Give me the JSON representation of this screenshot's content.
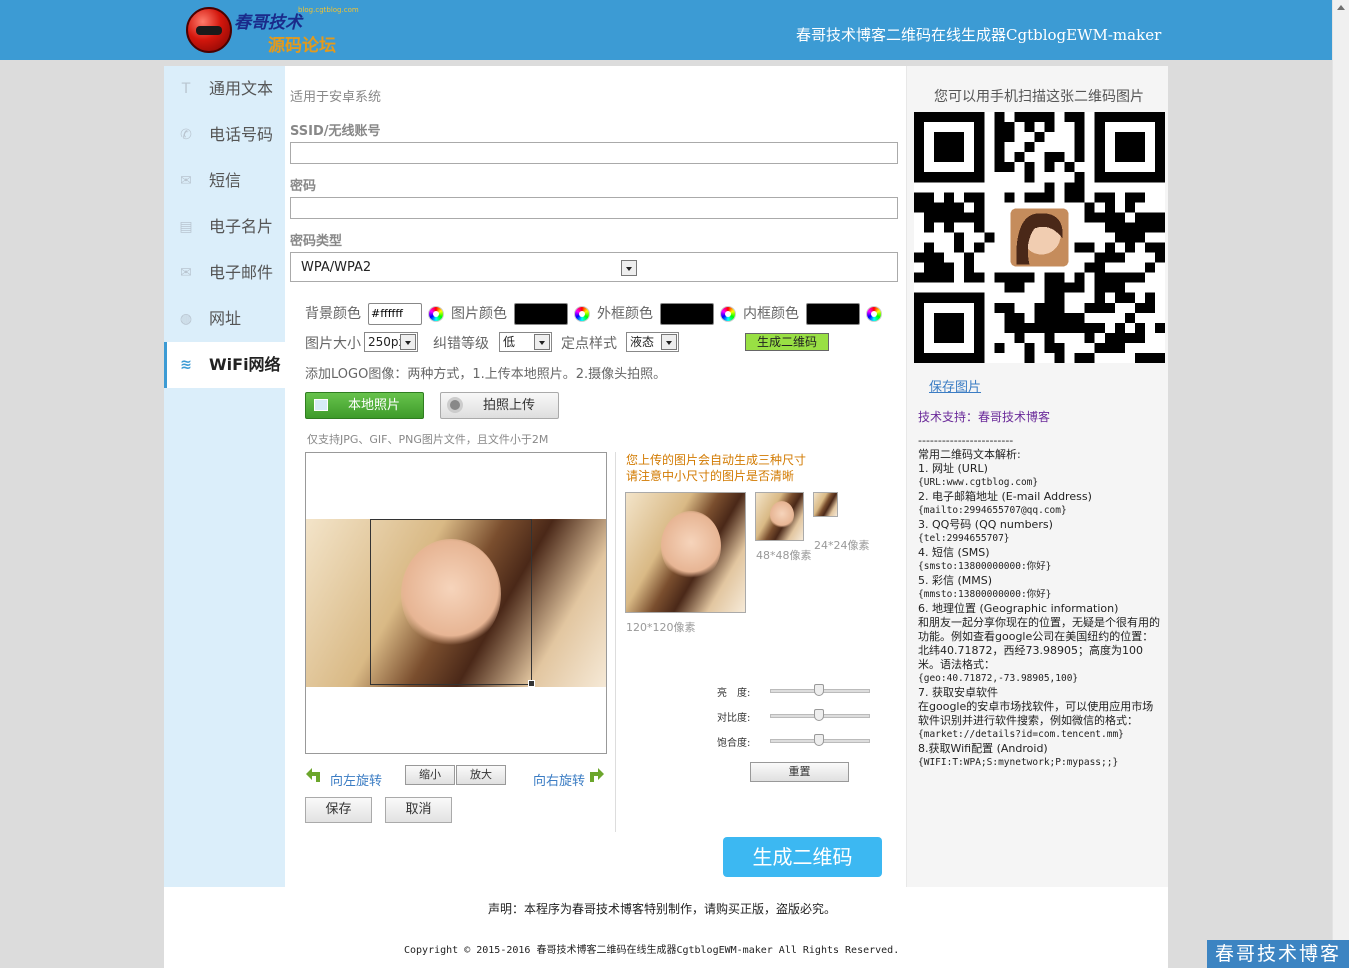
{
  "header": {
    "logo_line1": "春哥技术",
    "logo_line2": "源码论坛",
    "logo_url": "blog.cgtblog.com",
    "title": "春哥技术博客二维码在线生成器CgtblogEWM-maker"
  },
  "sidebar": {
    "items": [
      {
        "label": "通用文本",
        "icon": "text-icon",
        "glyph": "T"
      },
      {
        "label": "电话号码",
        "icon": "phone-icon",
        "glyph": "✆"
      },
      {
        "label": "短信",
        "icon": "chat-icon",
        "glyph": "✉"
      },
      {
        "label": "电子名片",
        "icon": "card-icon",
        "glyph": "▤"
      },
      {
        "label": "电子邮件",
        "icon": "mail-icon",
        "glyph": "✉"
      },
      {
        "label": "网址",
        "icon": "globe-icon",
        "glyph": "◍"
      },
      {
        "label": "WiFi网络",
        "icon": "wifi-icon",
        "glyph": "≋",
        "active": true
      }
    ]
  },
  "form": {
    "hint": "适用于安卓系统",
    "ssid_label": "SSID/无线账号",
    "ssid_value": "",
    "password_label": "密码",
    "password_value": "",
    "enc_label": "密码类型",
    "enc_value": "WPA/WPA2"
  },
  "options": {
    "bg_label": "背景颜色",
    "bg_value": "#ffffff",
    "img_label": "图片颜色",
    "outer_label": "外框颜色",
    "inner_label": "内框颜色",
    "size_label": "图片大小",
    "size_value": "250px",
    "ecc_label": "纠错等级",
    "ecc_value": "低",
    "style_label": "定点样式",
    "style_value": "液态",
    "gen_small": "生成二维码"
  },
  "logo_upload": {
    "line": "添加LOGO图像：两种方式，1.上传本地照片。2.摄像头拍照。",
    "local_btn": "本地照片",
    "camera_btn": "拍照上传",
    "support_note": "仅支持JPG、GIF、PNG图片文件，且文件小于2M",
    "auto_note1": "您上传的图片会自动生成三种尺寸",
    "auto_note2": "请注意中小尺寸的图片是否清晰",
    "thumb_120": "120*120像素",
    "thumb_48": "48*48像素",
    "thumb_24": "24*24像素",
    "rotate_left": "向左旋转",
    "rotate_right": "向右旋转",
    "zoom_out": "缩小",
    "zoom_in": "放大",
    "save": "保存",
    "cancel": "取消",
    "brightness": "亮　度:",
    "contrast": "对比度:",
    "saturation": "饱合度:",
    "reset": "重置"
  },
  "generate_btn": "生成二维码",
  "right": {
    "title": "您可以用手机扫描这张二维码图片",
    "save_link": "保存图片",
    "support_label": "技术支持：",
    "support_value": "春哥技术博客",
    "divider": "------------------------",
    "guide_title": "常用二维码文本解析:",
    "guide": [
      {
        "t": "1. 网址 (URL)",
        "m": false
      },
      {
        "t": "{URL:www.cgtblog.com}",
        "m": true
      },
      {
        "t": "2. 电子邮箱地址 (E-mail Address)",
        "m": false
      },
      {
        "t": "{mailto:2994655707@qq.com}",
        "m": true
      },
      {
        "t": "3. QQ号码 (QQ numbers)",
        "m": false
      },
      {
        "t": "{tel:2994655707}",
        "m": true
      },
      {
        "t": "4. 短信 (SMS)",
        "m": false
      },
      {
        "t": "{smsto:13800000000:你好}",
        "m": true
      },
      {
        "t": "5. 彩信 (MMS)",
        "m": false
      },
      {
        "t": "{mmsto:13800000000:你好}",
        "m": true
      },
      {
        "t": "6. 地理位置 (Geographic information)",
        "m": false
      },
      {
        "t": "和朋友一起分享你现在的位置，无疑是个很有用的功能。例如查看google公司在美国纽约的位置：北纬40.71872，西经73.98905；高度为100米。语法格式：",
        "m": false
      },
      {
        "t": "{geo:40.71872,-73.98905,100}",
        "m": true
      },
      {
        "t": "7. 获取安卓软件",
        "m": false
      },
      {
        "t": "在google的安卓市场找软件，可以使用应用市场软件识别并进行软件搜索，例如微信的格式：",
        "m": false
      },
      {
        "t": "{market://details?id=com.tencent.mm}",
        "m": true
      },
      {
        "t": "8.获取Wifi配置 (Android)",
        "m": false
      },
      {
        "t": "{WIFI:T:WPA;S:mynetwork;P:mypass;;}",
        "m": true
      }
    ]
  },
  "footer": {
    "note": "声明：本程序为春哥技术博客特别制作，请购买正版，盗版必究。",
    "copyright": "Copyright © 2015-2016 春哥技术博客二维码在线生成器CgtblogEWM-maker All Rights Reserved."
  },
  "watermark": "春哥技术博客",
  "colors": {
    "header": "#3c9bd4",
    "sidebar": "#dbeefa",
    "generate": "#3cb8f2",
    "small_generate": "#99e044"
  }
}
